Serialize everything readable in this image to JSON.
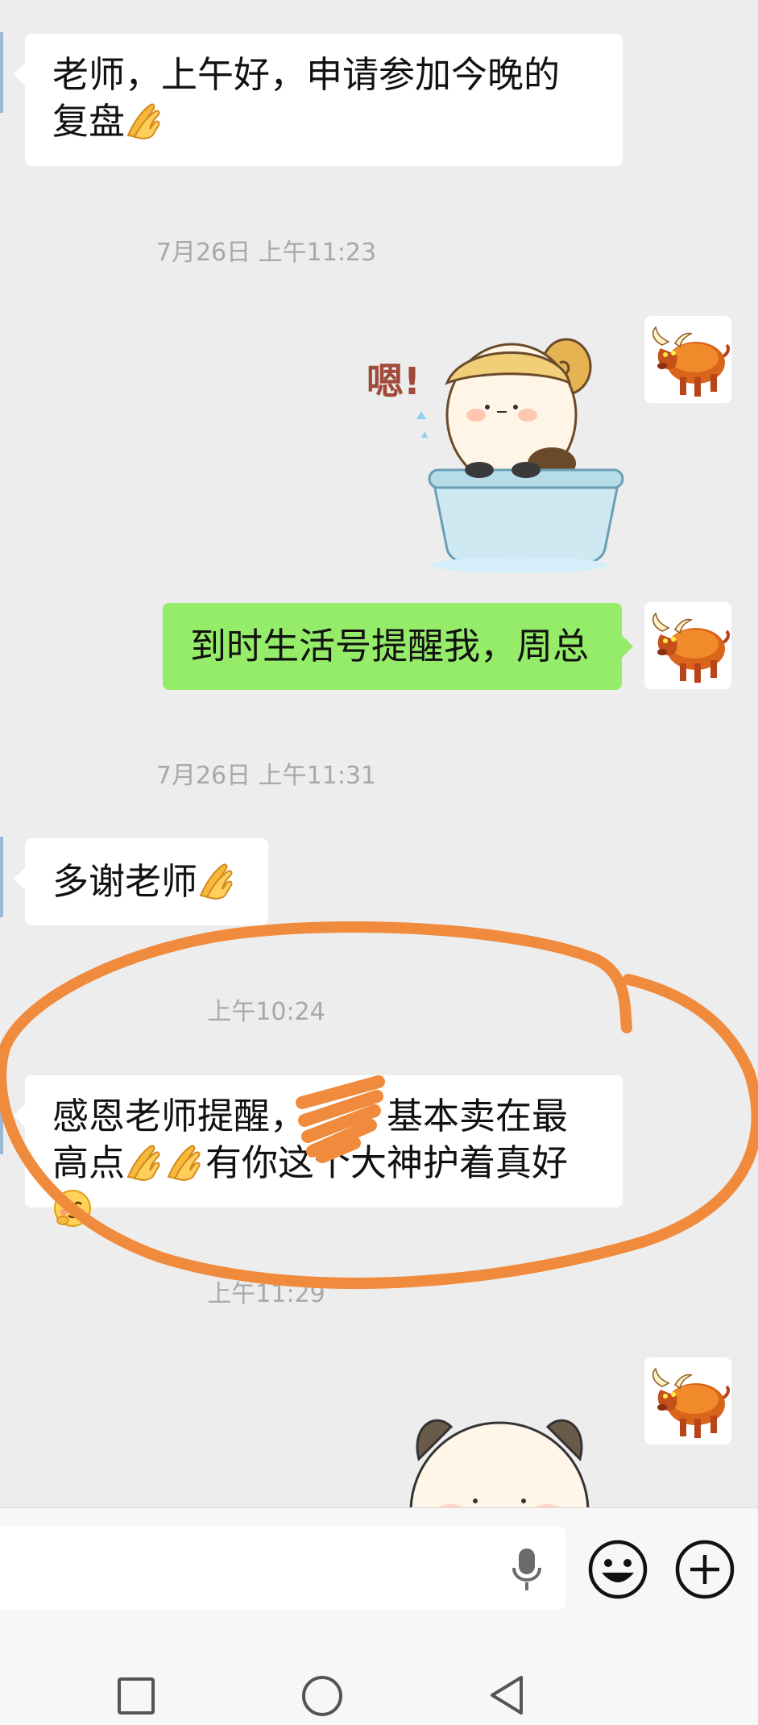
{
  "messages": {
    "m1": "老师，上午好，申请参加今晚的复盘",
    "m2": "到时生活号提醒我，周总",
    "m3": "多谢老师",
    "m4_part1": "感恩老师提醒，",
    "m4_part2": "基本卖在最高点",
    "m4_part3": "有你这个大神护着真好"
  },
  "timestamps": {
    "t1": "7月26日 上午11:23",
    "t2": "7月26日 上午11:31",
    "t3": "上午10:24",
    "t4": "上午11:29"
  },
  "sticker": {
    "text": "嗯!"
  },
  "icons": {
    "avatar": "bull-avatar-icon",
    "pray": "praying-hands-emoji",
    "shy": "shy-face-emoji",
    "voice": "microphone-icon",
    "emoji_button": "smiley-face-icon",
    "more": "plus-circle-icon",
    "nav": [
      "square-recent-icon",
      "circle-home-icon",
      "triangle-back-icon"
    ]
  },
  "colors": {
    "chat_bg": "#ededed",
    "incoming_bubble": "#ffffff",
    "outgoing_bubble": "#95ec69",
    "annotation": "#f08a3c"
  }
}
